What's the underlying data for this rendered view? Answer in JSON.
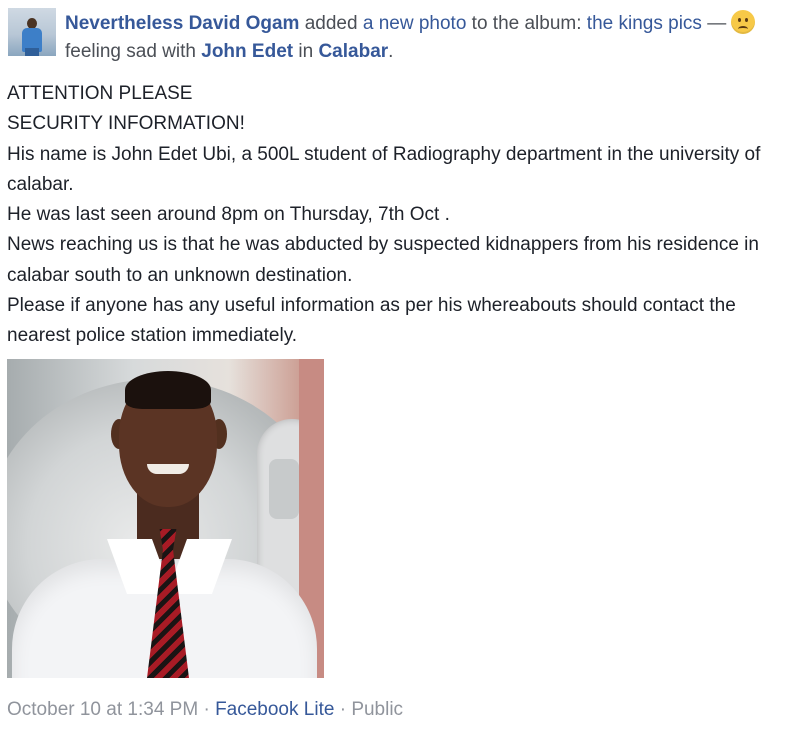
{
  "header": {
    "author": "Nevertheless David Ogam",
    "action_text": "added",
    "object_link": "a new photo",
    "album_prefix": "to the album:",
    "album_name": "the kings pics",
    "separator": "—",
    "feeling_icon": "sad-face-emoji",
    "feeling_text": "feeling sad with",
    "tagged_person": "John Edet",
    "location_prefix": "in",
    "location": "Calabar",
    "location_suffix": "."
  },
  "post": {
    "lines": [
      "ATTENTION PLEASE",
      "SECURITY INFORMATION!",
      "His name is John Edet Ubi, a 500L student of Radiography department in the university of calabar.",
      "He was last seen around 8pm on Thursday, 7th Oct .",
      "News reaching us is that he was abducted by suspected kidnappers from his residence in calabar south to an unknown destination.",
      "Please if anyone has any useful information as per his whereabouts should contact the nearest police station immediately."
    ]
  },
  "footer": {
    "timestamp": "October 10 at 1:34 PM",
    "dot": "·",
    "app": "Facebook Lite",
    "privacy": "Public"
  },
  "colors": {
    "link": "#365899",
    "meta": "#90949c",
    "text": "#1d2129"
  }
}
